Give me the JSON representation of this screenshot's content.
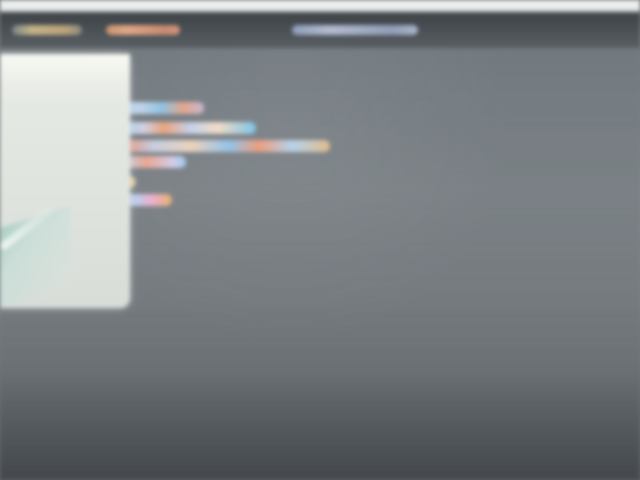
{
  "colors": {
    "background": "#7a8085",
    "toolbar": "#4a4f53",
    "tab_active": "#d2be8f",
    "tab_second": "#eaa77d",
    "tab_third": "#a4b4d4",
    "dialog": "#e5e9e4"
  },
  "icons": {
    "dialog_action": "confirm-icon"
  }
}
